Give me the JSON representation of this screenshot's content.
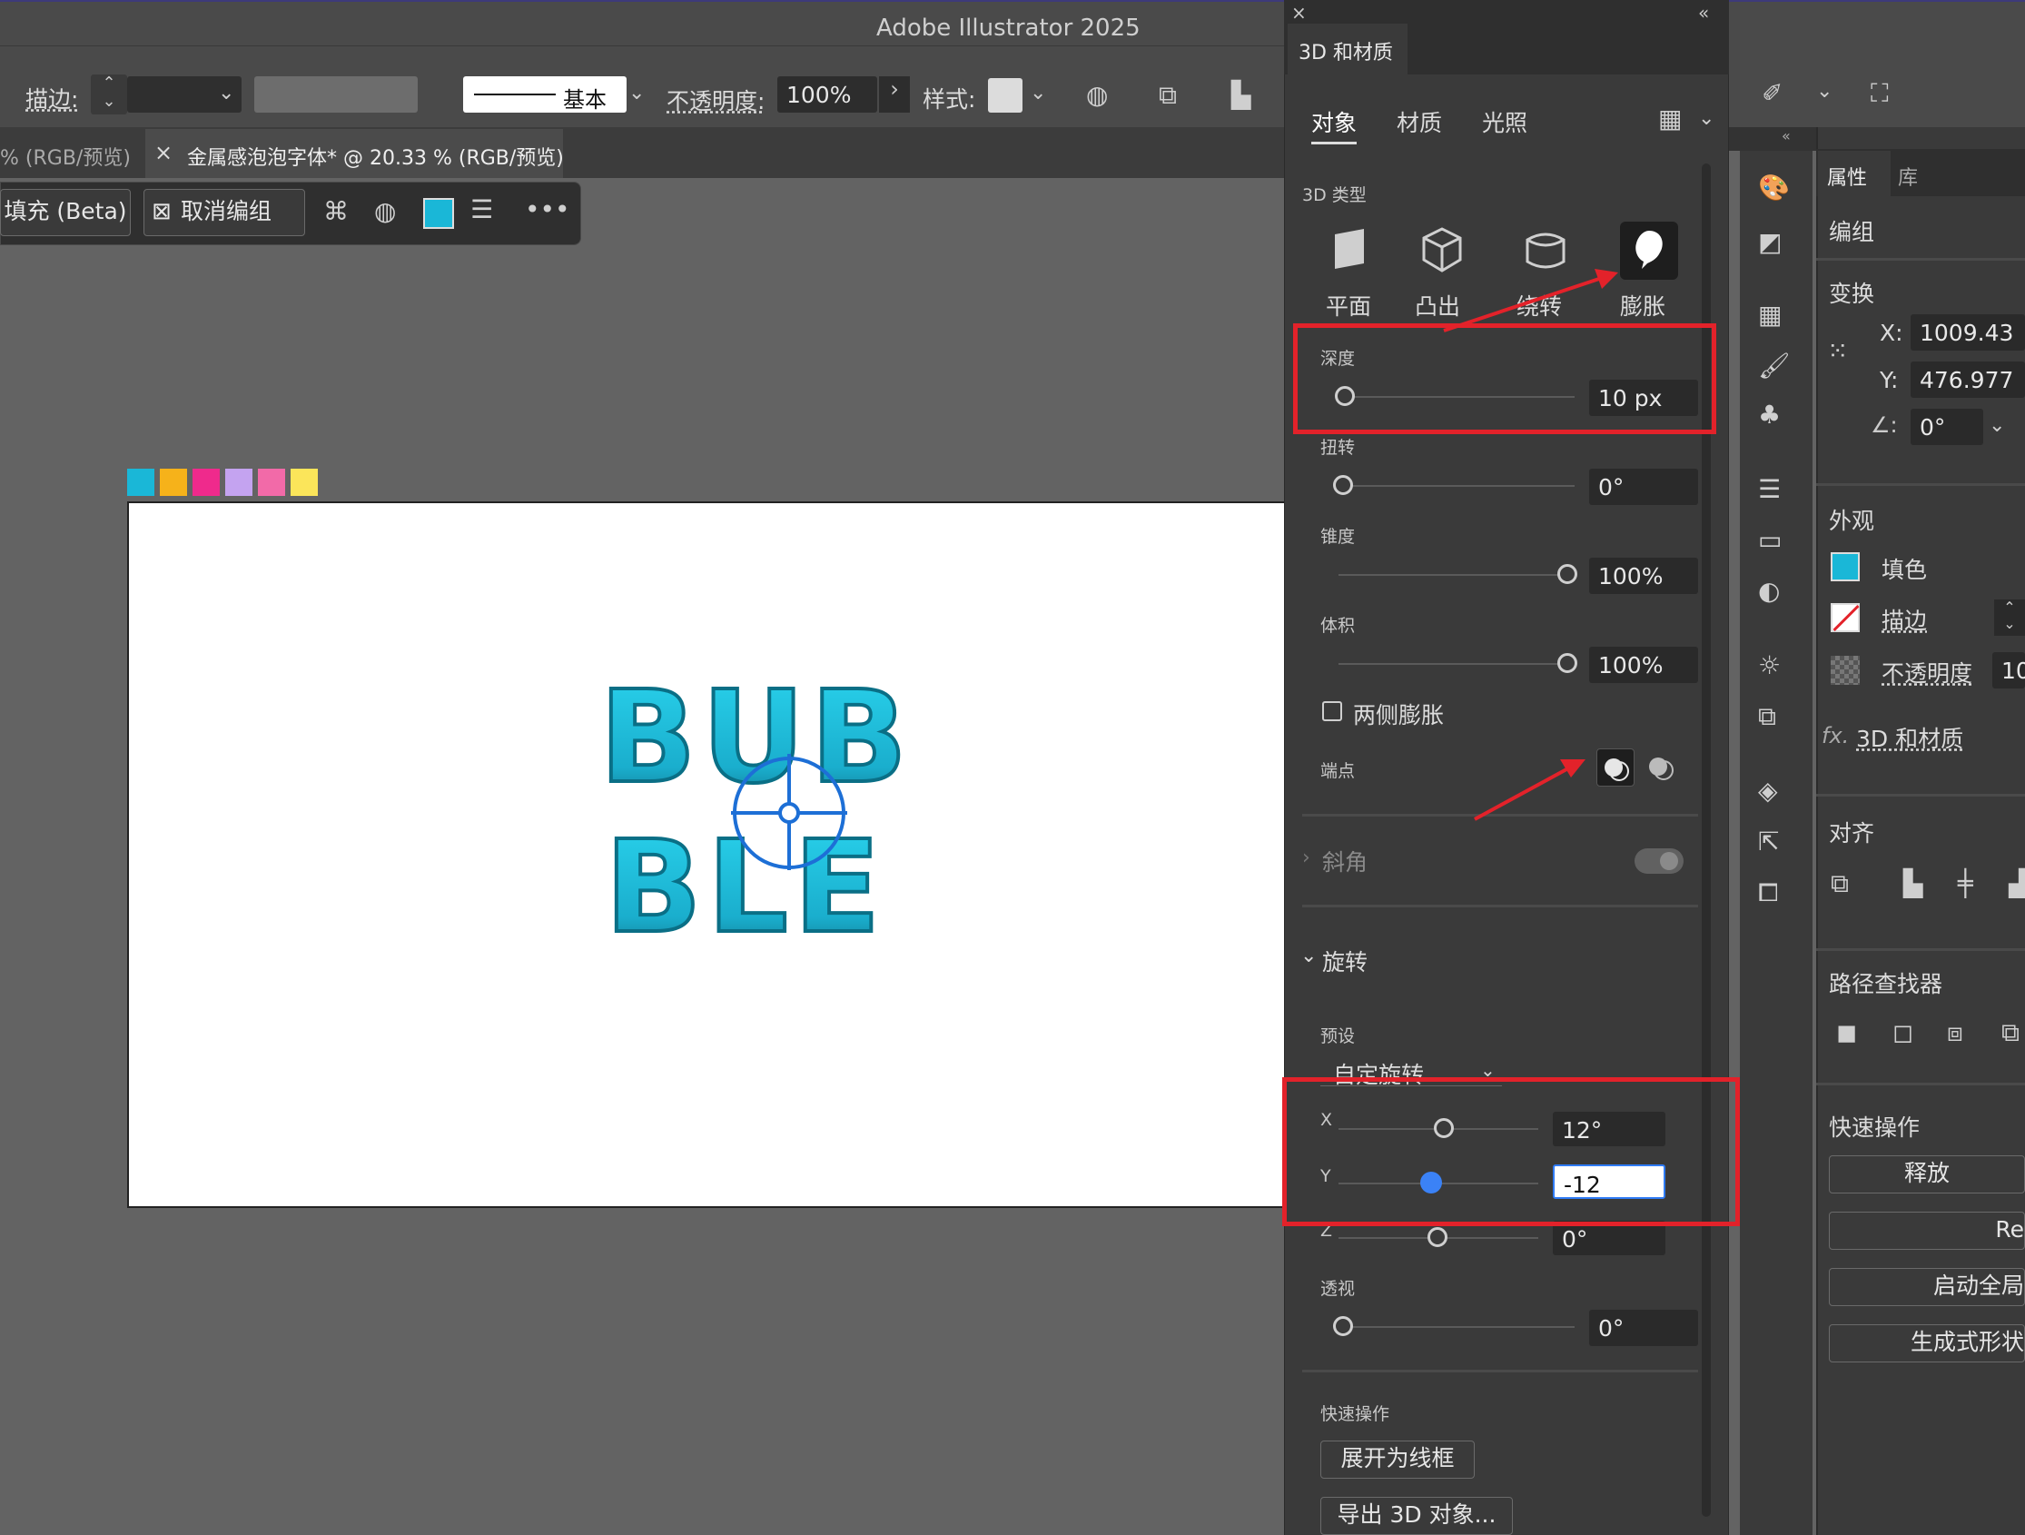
{
  "app": {
    "title": "Adobe Illustrator 2025"
  },
  "control_bar": {
    "stroke_label": "描边:",
    "stroke_style": "基本",
    "opacity_label": "不透明度:",
    "opacity_value": "100%",
    "style_label": "样式:"
  },
  "tabs": [
    {
      "label": "% (RGB/预览)"
    },
    {
      "label": "金属感泡泡字体* @ 20.33 % (RGB/预览)"
    }
  ],
  "context_bar": {
    "fill_beta": "填充 (Beta)",
    "ungroup": "取消编组"
  },
  "swatches": [
    "#1ab7d7",
    "#f6b21a",
    "#ef2a8c",
    "#c4a3f0",
    "#f26aa8",
    "#fbe55a"
  ],
  "artwork": {
    "line1": "BUB",
    "line2": "BLE",
    "color": "#22c3e0"
  },
  "panel3d": {
    "title": "3D 和材质",
    "tabs": [
      "对象",
      "材质",
      "光照"
    ],
    "type_label": "3D 类型",
    "types": [
      "平面",
      "凸出",
      "绕转",
      "膨胀"
    ],
    "depth": {
      "label": "深度",
      "value": "10 px"
    },
    "twist": {
      "label": "扭转",
      "value": "0°"
    },
    "taper": {
      "label": "锥度",
      "value": "100%"
    },
    "volume": {
      "label": "体积",
      "value": "100%"
    },
    "both_sides": "两侧膨胀",
    "cap_label": "端点",
    "bevel_label": "斜角",
    "rotation": {
      "label": "旋转",
      "preset_label": "预设",
      "preset_value": "自定旋转",
      "x_label": "X",
      "x_value": "12°",
      "y_label": "Y",
      "y_value": "-12",
      "z_label": "Z",
      "z_value": "0°",
      "persp_label": "透视",
      "persp_value": "0°"
    },
    "quick_actions": {
      "label": "快速操作",
      "expand": "展开为线框",
      "export": "导出 3D 对象..."
    }
  },
  "props": {
    "tabs": [
      "属性",
      "库"
    ],
    "group": "编组",
    "transform": {
      "label": "变换",
      "x_label": "X:",
      "x_value": "1009.43",
      "y_label": "Y:",
      "y_value": "476.977",
      "angle_value": "0°"
    },
    "appearance": {
      "label": "外观",
      "fill": "填色",
      "stroke": "描边",
      "opacity": "不透明度",
      "opacity_value": "10",
      "fx": "3D 和材质"
    },
    "align": "对齐",
    "pathfinder": "路径查找器",
    "quick": {
      "label": "快速操作",
      "release": "释放",
      "re": "Re",
      "start": "启动全局",
      "generate": "生成式形状"
    }
  }
}
